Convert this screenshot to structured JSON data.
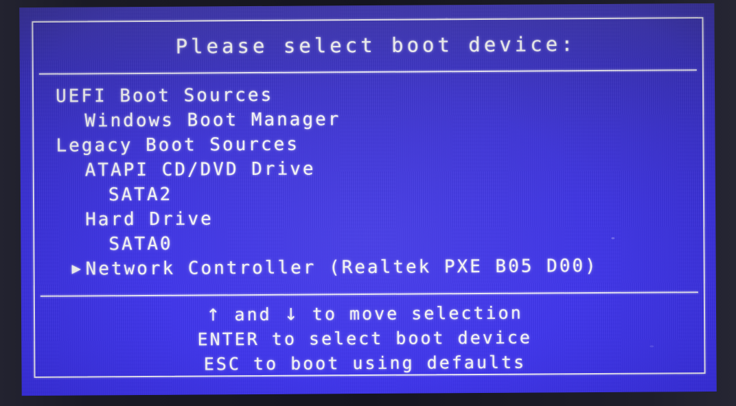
{
  "screen": {
    "title": "Please select boot device:",
    "colors": {
      "screen_blue_top": "#4038b8",
      "screen_blue_bottom": "#382df0",
      "text_white": "#fdfdff",
      "bezel_dark": "#1b1b26"
    }
  },
  "device_list": [
    {
      "label": "UEFI Boot Sources",
      "indent": 0,
      "selected": false,
      "is_group": true
    },
    {
      "label": "Windows Boot Manager",
      "indent": 1,
      "selected": false,
      "is_group": false
    },
    {
      "label": "Legacy Boot Sources",
      "indent": 0,
      "selected": false,
      "is_group": true
    },
    {
      "label": "ATAPI CD/DVD Drive",
      "indent": 1,
      "selected": false,
      "is_group": false
    },
    {
      "label": "SATA2",
      "indent": 2,
      "selected": false,
      "is_group": false
    },
    {
      "label": "Hard Drive",
      "indent": 1,
      "selected": false,
      "is_group": false
    },
    {
      "label": "SATA0",
      "indent": 2,
      "selected": false,
      "is_group": false
    },
    {
      "label": "Network Controller (Realtek PXE B05 D00)",
      "indent": 1,
      "selected": true,
      "is_group": false
    }
  ],
  "selection_marker": "▶",
  "footer": {
    "hints": [
      {
        "parts": [
          {
            "type": "glyph",
            "text": "↑"
          },
          {
            "type": "text",
            "text": " and "
          },
          {
            "type": "glyph",
            "text": "↓"
          },
          {
            "type": "text",
            "text": " to move selection"
          }
        ]
      },
      {
        "parts": [
          {
            "type": "text",
            "text": "ENTER to select boot device"
          }
        ]
      },
      {
        "parts": [
          {
            "type": "text",
            "text": "ESC to boot using defaults"
          }
        ]
      }
    ]
  }
}
